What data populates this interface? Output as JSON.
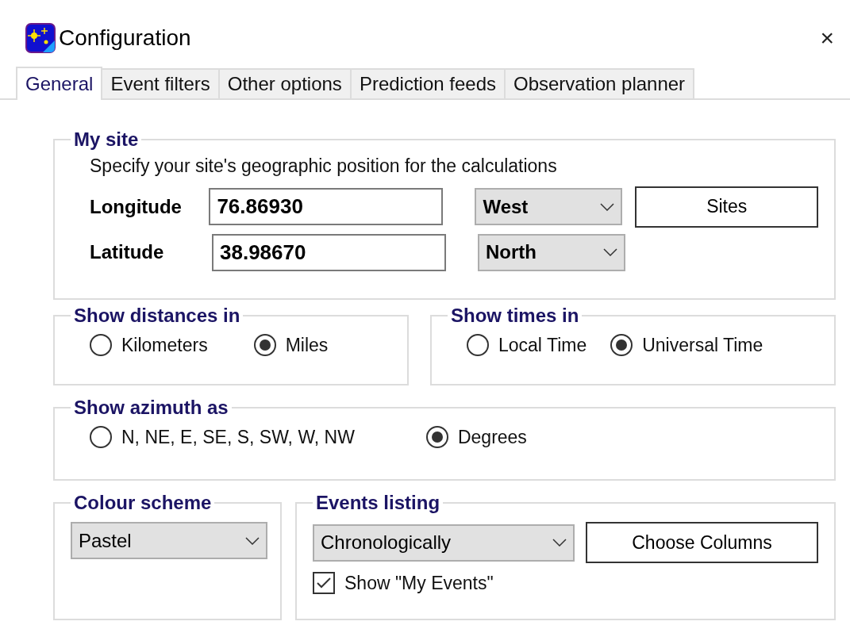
{
  "window": {
    "title": "Configuration",
    "close": "×"
  },
  "tabs": [
    {
      "label": "General",
      "selected": true
    },
    {
      "label": "Event filters",
      "selected": false
    },
    {
      "label": "Other options",
      "selected": false
    },
    {
      "label": "Prediction feeds",
      "selected": false
    },
    {
      "label": "Observation planner",
      "selected": false
    }
  ],
  "my_site": {
    "title": "My site",
    "description": "Specify your site's geographic position for the calculations",
    "fields": [
      {
        "label": "Longitude",
        "value": "76.86930",
        "direction": "West"
      },
      {
        "label": "Latitude",
        "value": "38.98670",
        "direction": "North"
      }
    ],
    "sites_button": "Sites"
  },
  "distances": {
    "title": "Show distances in",
    "options": [
      {
        "label": "Kilometers",
        "selected": false
      },
      {
        "label": "Miles",
        "selected": true
      }
    ]
  },
  "times": {
    "title": "Show times in",
    "options": [
      {
        "label": "Local Time",
        "selected": false
      },
      {
        "label": "Universal Time",
        "selected": true
      }
    ]
  },
  "azimuth": {
    "title": "Show azimuth as",
    "options": [
      {
        "label": "N, NE, E, SE, S, SW, W, NW",
        "selected": false
      },
      {
        "label": "Degrees",
        "selected": true
      }
    ]
  },
  "colour_scheme": {
    "title": "Colour scheme",
    "value": "Pastel"
  },
  "events_listing": {
    "title": "Events listing",
    "value": "Chronologically",
    "button": "Choose Columns",
    "checkbox": {
      "label": "Show \"My Events\"",
      "checked": true
    }
  }
}
